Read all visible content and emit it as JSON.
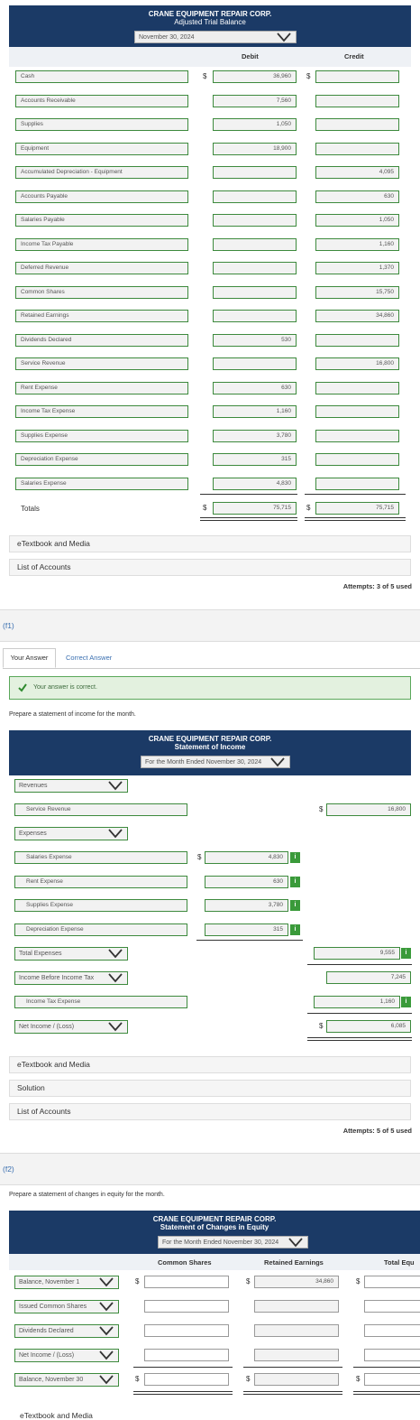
{
  "trial_balance": {
    "company": "CRANE EQUIPMENT REPAIR CORP.",
    "title": "Adjusted Trial Balance",
    "date_select": "November 30, 2024",
    "debit_label": "Debit",
    "credit_label": "Credit",
    "currency": "$",
    "rows": [
      {
        "account": "Cash",
        "debit": "36,960",
        "credit": ""
      },
      {
        "account": "Accounts Receivable",
        "debit": "7,560",
        "credit": ""
      },
      {
        "account": "Supplies",
        "debit": "1,050",
        "credit": ""
      },
      {
        "account": "Equipment",
        "debit": "18,900",
        "credit": ""
      },
      {
        "account": "Accumulated Depreciation - Equipment",
        "debit": "",
        "credit": "4,095"
      },
      {
        "account": "Accounts Payable",
        "debit": "",
        "credit": "630"
      },
      {
        "account": "Salaries Payable",
        "debit": "",
        "credit": "1,050"
      },
      {
        "account": "Income Tax Payable",
        "debit": "",
        "credit": "1,160"
      },
      {
        "account": "Deferred Revenue",
        "debit": "",
        "credit": "1,370"
      },
      {
        "account": "Common Shares",
        "debit": "",
        "credit": "15,750"
      },
      {
        "account": "Retained Earnings",
        "debit": "",
        "credit": "34,860"
      },
      {
        "account": "Dividends Declared",
        "debit": "530",
        "credit": ""
      },
      {
        "account": "Service Revenue",
        "debit": "",
        "credit": "16,800"
      },
      {
        "account": "Rent Expense",
        "debit": "630",
        "credit": ""
      },
      {
        "account": "Income Tax Expense",
        "debit": "1,160",
        "credit": ""
      },
      {
        "account": "Supplies Expense",
        "debit": "3,780",
        "credit": ""
      },
      {
        "account": "Depreciation Expense",
        "debit": "315",
        "credit": ""
      },
      {
        "account": "Salaries Expense",
        "debit": "4,830",
        "credit": ""
      }
    ],
    "totals_label": "Totals",
    "total_debit": "75,715",
    "total_credit": "75,715"
  },
  "links1": {
    "etextbook": "eTextbook and Media",
    "accounts": "List of Accounts"
  },
  "attempts1": "Attempts: 3 of 5 used",
  "section_f1": "(f1)",
  "tabs": {
    "your_answer": "Your Answer",
    "correct_answer": "Correct Answer"
  },
  "correct_msg": "Your answer is correct.",
  "income_prompt": "Prepare a statement of income for the month.",
  "income": {
    "company": "CRANE EQUIPMENT REPAIR CORP.",
    "title": "Statement of Income",
    "period_select": "For the Month Ended November 30, 2024",
    "revenues_select": "Revenues",
    "service_revenue_label": "Service Revenue",
    "service_revenue_value": "16,800",
    "expenses_select": "Expenses",
    "expense_rows": [
      {
        "label": "Salaries Expense",
        "value": "4,830"
      },
      {
        "label": "Rent Expense",
        "value": "630"
      },
      {
        "label": "Supplies Expense",
        "value": "3,780"
      },
      {
        "label": "Depreciation Expense",
        "value": "315"
      }
    ],
    "total_expenses_select": "Total Expenses",
    "total_expenses_value": "9,555",
    "income_before_tax_select": "Income Before Income Tax",
    "income_before_tax_value": "7,245",
    "income_tax_label": "Income Tax Expense",
    "income_tax_value": "1,160",
    "net_income_select": "Net Income / (Loss)",
    "net_income_value": "6,085",
    "currency": "$",
    "info": "i"
  },
  "links2": {
    "etextbook": "eTextbook and Media",
    "solution": "Solution",
    "accounts": "List of Accounts"
  },
  "attempts2": "Attempts: 5 of 5 used",
  "section_f2": "(f2)",
  "equity_prompt": "Prepare a statement of changes in equity for the month.",
  "equity": {
    "company": "CRANE EQUIPMENT REPAIR CORP.",
    "title": "Statement of Changes in Equity",
    "period_select": "For the Month Ended November 30, 2024",
    "col_common": "Common Shares",
    "col_retained": "Retained Earnings",
    "col_total": "Total Equ",
    "currency": "$",
    "rows": [
      {
        "label": "Balance, November 1",
        "common": "",
        "retained": "34,860",
        "total": ""
      },
      {
        "label": "Issued Common Shares",
        "common": "",
        "retained": "",
        "total": ""
      },
      {
        "label": "Dividends Declared",
        "common": "",
        "retained": "",
        "total": ""
      },
      {
        "label": "Net Income / (Loss)",
        "common": "",
        "retained": "",
        "total": ""
      },
      {
        "label": "Balance, November 30",
        "common": "",
        "retained": "",
        "total": ""
      }
    ]
  },
  "footer_partial": "eTextbook and Media"
}
